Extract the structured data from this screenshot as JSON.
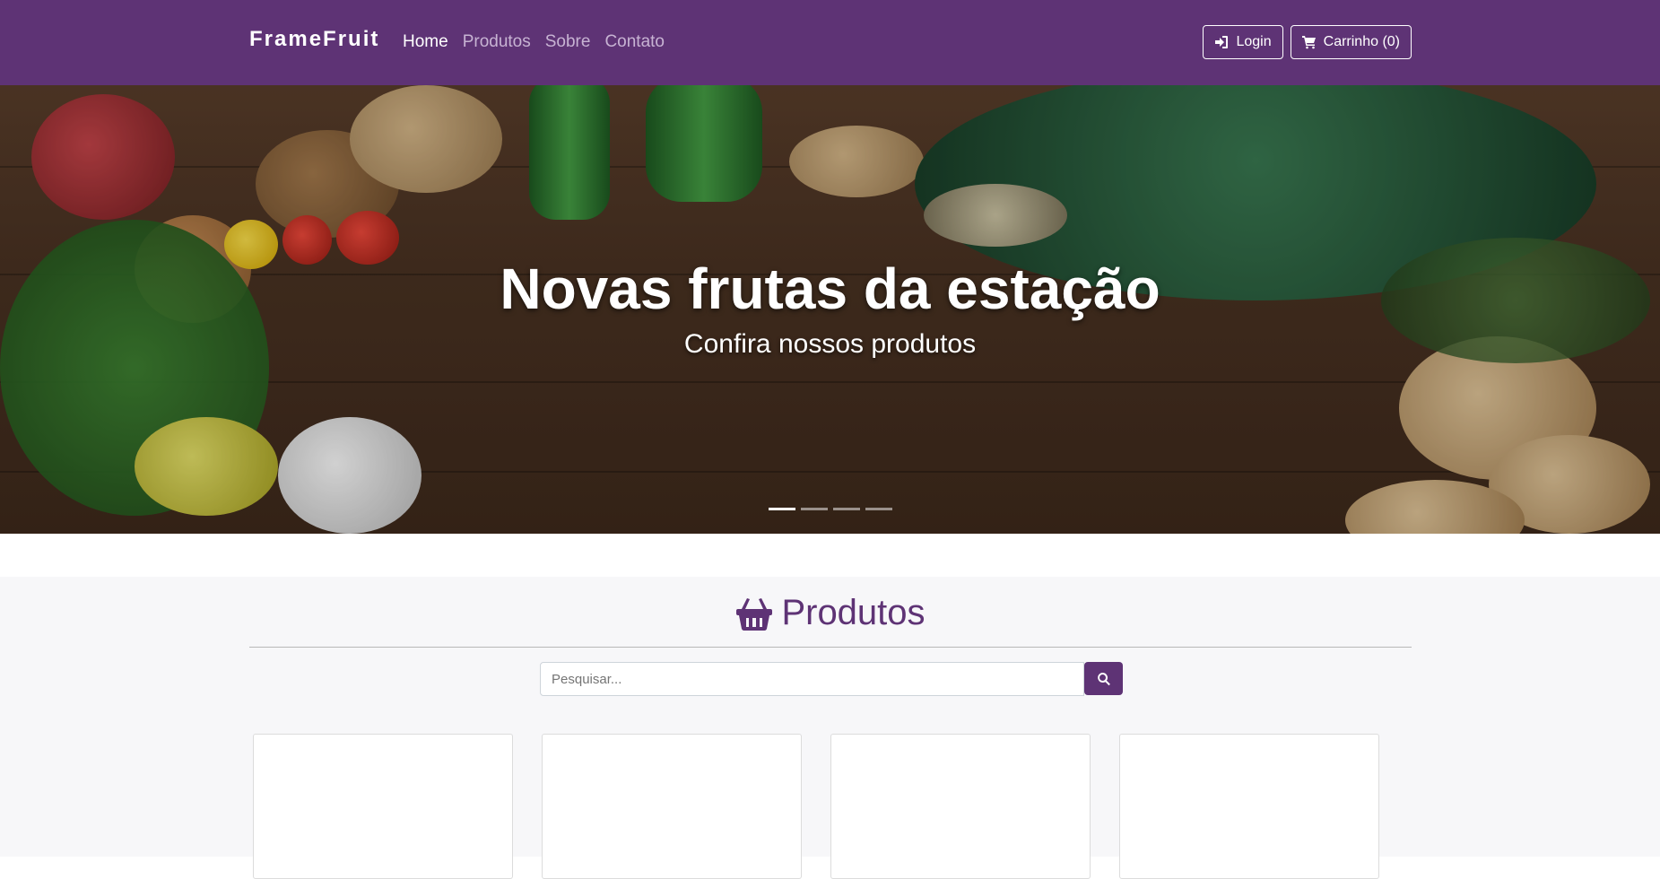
{
  "navbar": {
    "brand": "FrameFruit",
    "links": [
      "Home",
      "Produtos",
      "Sobre",
      "Contato"
    ],
    "login_label": "Login",
    "cart_label": "Carrinho (0)"
  },
  "hero": {
    "title": "Novas frutas da estação",
    "subtitle": "Confira nossos produtos",
    "slides_count": 4,
    "active_slide": 1
  },
  "products": {
    "title": "Produtos",
    "search_placeholder": "Pesquisar..."
  },
  "colors": {
    "brand": "#5e3375",
    "background": "#f7f7f9"
  },
  "icons": [
    "sign-in-icon",
    "cart-icon",
    "basket-icon",
    "search-icon"
  ]
}
